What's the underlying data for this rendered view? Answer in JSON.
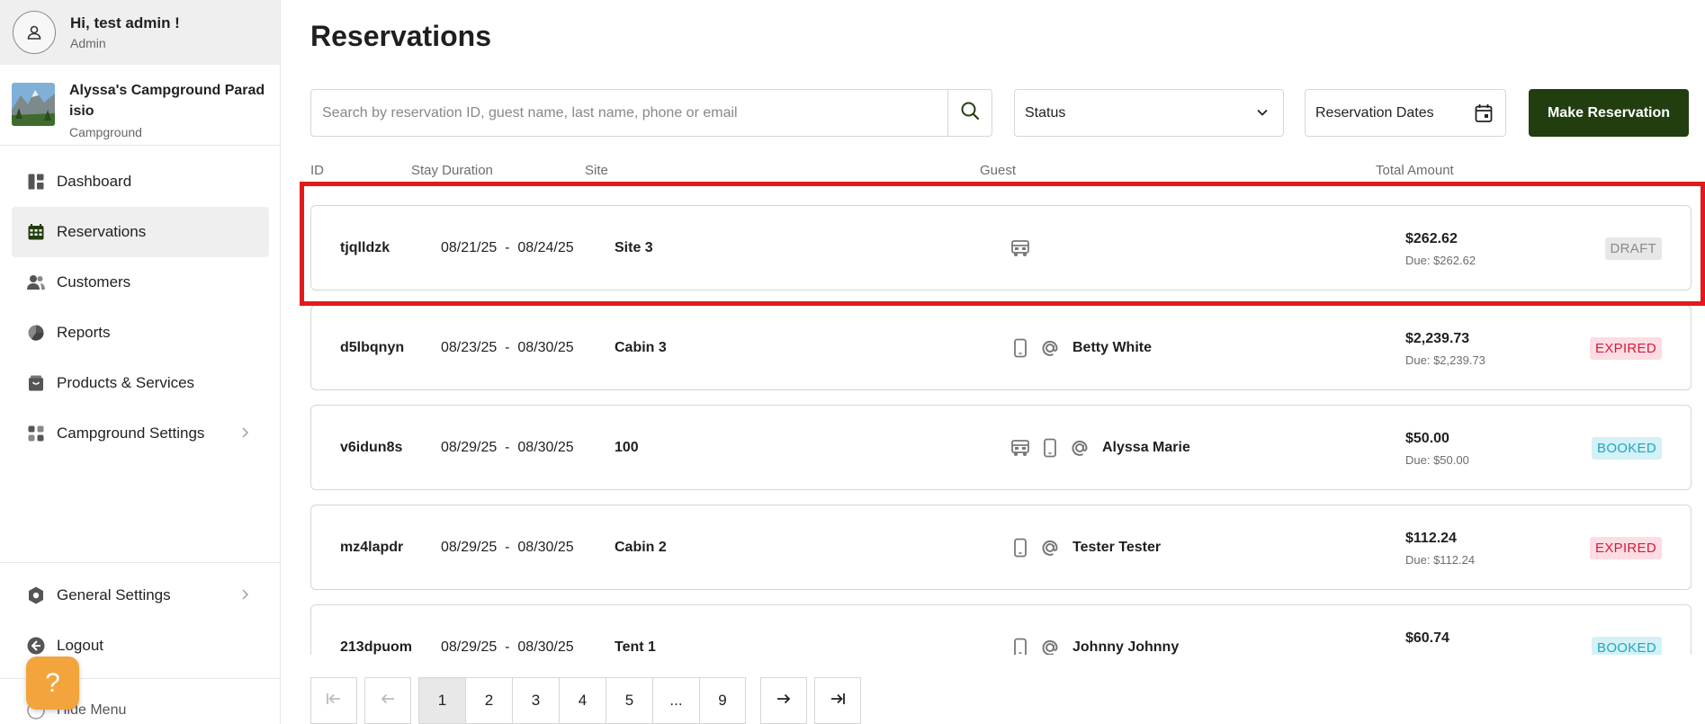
{
  "user": {
    "greeting": "Hi, test admin !",
    "role": "Admin"
  },
  "campground": {
    "name": "Alyssa's Campground Paradisio",
    "type": "Campground"
  },
  "nav": {
    "items": [
      {
        "label": "Dashboard",
        "icon": "dashboard-icon"
      },
      {
        "label": "Reservations",
        "icon": "calendar-icon",
        "active": true
      },
      {
        "label": "Customers",
        "icon": "customers-icon"
      },
      {
        "label": "Reports",
        "icon": "pie-chart-icon"
      },
      {
        "label": "Products & Services",
        "icon": "bag-icon"
      },
      {
        "label": "Campground Settings",
        "icon": "apps-icon"
      }
    ],
    "general_settings": "General Settings",
    "logout": "Logout",
    "hide_menu": "Hide Menu"
  },
  "help": {
    "label": "?"
  },
  "page": {
    "title": "Reservations"
  },
  "filters": {
    "search_placeholder": "Search by reservation ID, guest name, last name, phone or email",
    "status_label": "Status",
    "dates_label": "Reservation Dates",
    "make_reservation": "Make Reservation"
  },
  "table": {
    "headers": {
      "id": "ID",
      "stay": "Stay Duration",
      "site": "Site",
      "guest": "Guest",
      "total": "Total Amount"
    },
    "rows": [
      {
        "id": "tjqlldzk",
        "start": "08/21/25",
        "end": "08/24/25",
        "site": "Site 3",
        "icons": [
          "rv-icon"
        ],
        "guest": "",
        "total": "$262.62",
        "due": "Due: $262.62",
        "status": "DRAFT"
      },
      {
        "id": "d5lbqnyn",
        "start": "08/23/25",
        "end": "08/30/25",
        "site": "Cabin 3",
        "icons": [
          "phone-icon",
          "email-icon"
        ],
        "guest": "Betty White",
        "total": "$2,239.73",
        "due": "Due: $2,239.73",
        "status": "EXPIRED"
      },
      {
        "id": "v6idun8s",
        "start": "08/29/25",
        "end": "08/30/25",
        "site": "100",
        "icons": [
          "rv-icon",
          "phone-icon",
          "email-icon"
        ],
        "guest": "Alyssa Marie",
        "total": "$50.00",
        "due": "Due: $50.00",
        "status": "BOOKED"
      },
      {
        "id": "mz4lapdr",
        "start": "08/29/25",
        "end": "08/30/25",
        "site": "Cabin 2",
        "icons": [
          "phone-icon",
          "email-icon"
        ],
        "guest": "Tester Tester",
        "total": "$112.24",
        "due": "Due: $112.24",
        "status": "EXPIRED"
      },
      {
        "id": "213dpuom",
        "start": "08/29/25",
        "end": "08/30/25",
        "site": "Tent 1",
        "icons": [
          "phone-icon",
          "email-icon"
        ],
        "guest": "Johnny Johnny",
        "total": "$60.74",
        "due": "",
        "status": "BOOKED"
      }
    ],
    "range_separator": "-"
  },
  "pagination": {
    "pages": [
      "1",
      "2",
      "3",
      "4",
      "5",
      "...",
      "9"
    ],
    "current": "1"
  },
  "colors": {
    "primary": "#223e0f",
    "highlight": "#e11b1b",
    "draft": "#8a8a8a",
    "expired": "#d21b3c",
    "booked": "#1fa7be",
    "help": "#f3a43c"
  }
}
